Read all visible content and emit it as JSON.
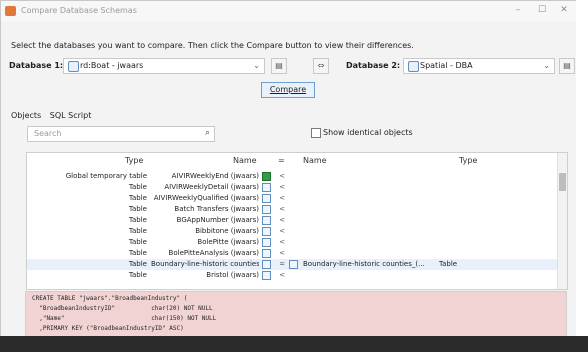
{
  "window": {
    "title": "Compare Database Schemas",
    "minimize": "–",
    "maximize": "☐",
    "close": "✕"
  },
  "instructions": "Select the databases you want to compare. Then click the Compare button to view their differences.",
  "database1": {
    "label": "Database 1:",
    "value": "rd:Boat - jwaars",
    "icon": "database-icon"
  },
  "database2": {
    "label": "Database 2:",
    "value": "Spatial - DBA",
    "icon": "database-icon"
  },
  "swap_label": "⇔",
  "compare_label": "Compare",
  "tabs": [
    "Objects",
    "SQL Script"
  ],
  "search": {
    "placeholder": "Search"
  },
  "show_identical_label": "Show identical objects",
  "grid": {
    "headers": {
      "type_left": "Type",
      "name_left": "Name",
      "eq": "=",
      "name_right": "Name",
      "type_right": "Type"
    },
    "rows": [
      {
        "type": "Global temporary table",
        "name": "AIVIRWeeklyEnd (jwaars)",
        "op": "<",
        "name_right": "",
        "type_right": "",
        "icon": "green"
      },
      {
        "type": "Table",
        "name": "AIVIRWeeklyDetail (jwaars)",
        "op": "<",
        "name_right": "",
        "type_right": ""
      },
      {
        "type": "Table",
        "name": "AIVIRWeeklyQualified (jwaars)",
        "op": "<",
        "name_right": "",
        "type_right": ""
      },
      {
        "type": "Table",
        "name": "Batch Transfers (jwaars)",
        "op": "<",
        "name_right": "",
        "type_right": ""
      },
      {
        "type": "Table",
        "name": "BGAppNumber (jwaars)",
        "op": "<",
        "name_right": "",
        "type_right": ""
      },
      {
        "type": "Table",
        "name": "Bibbitone (jwaars)",
        "op": "<",
        "name_right": "",
        "type_right": ""
      },
      {
        "type": "Table",
        "name": "BolePitte (jwaars)",
        "op": "<",
        "name_right": "",
        "type_right": ""
      },
      {
        "type": "Table",
        "name": "BolePitteAnalysis (jwaars)",
        "op": "<",
        "name_right": "",
        "type_right": ""
      },
      {
        "type": "Table",
        "name": "Boundary-line-historic counties_(...",
        "op": "=",
        "name_right": "Boundary-line-historic counties_(...",
        "type_right": "Table"
      },
      {
        "type": "Table",
        "name": "Bristol (jwaars)",
        "op": "<",
        "name_right": "",
        "type_right": ""
      }
    ]
  },
  "sql": {
    "lines": [
      "CREATE TABLE \"jwaars\".\"BroadbeanIndustry\" (",
      "  \"BroadbeanIndustryID\"          char(20) NOT NULL",
      "  ,\"Name\"                        char(150) NOT NULL",
      "  ,PRIMARY KEY (\"BroadbeanIndustryID\" ASC)"
    ]
  },
  "colors": {
    "sql_background": "#f2d3d3",
    "accent": "#6e9fd2"
  }
}
